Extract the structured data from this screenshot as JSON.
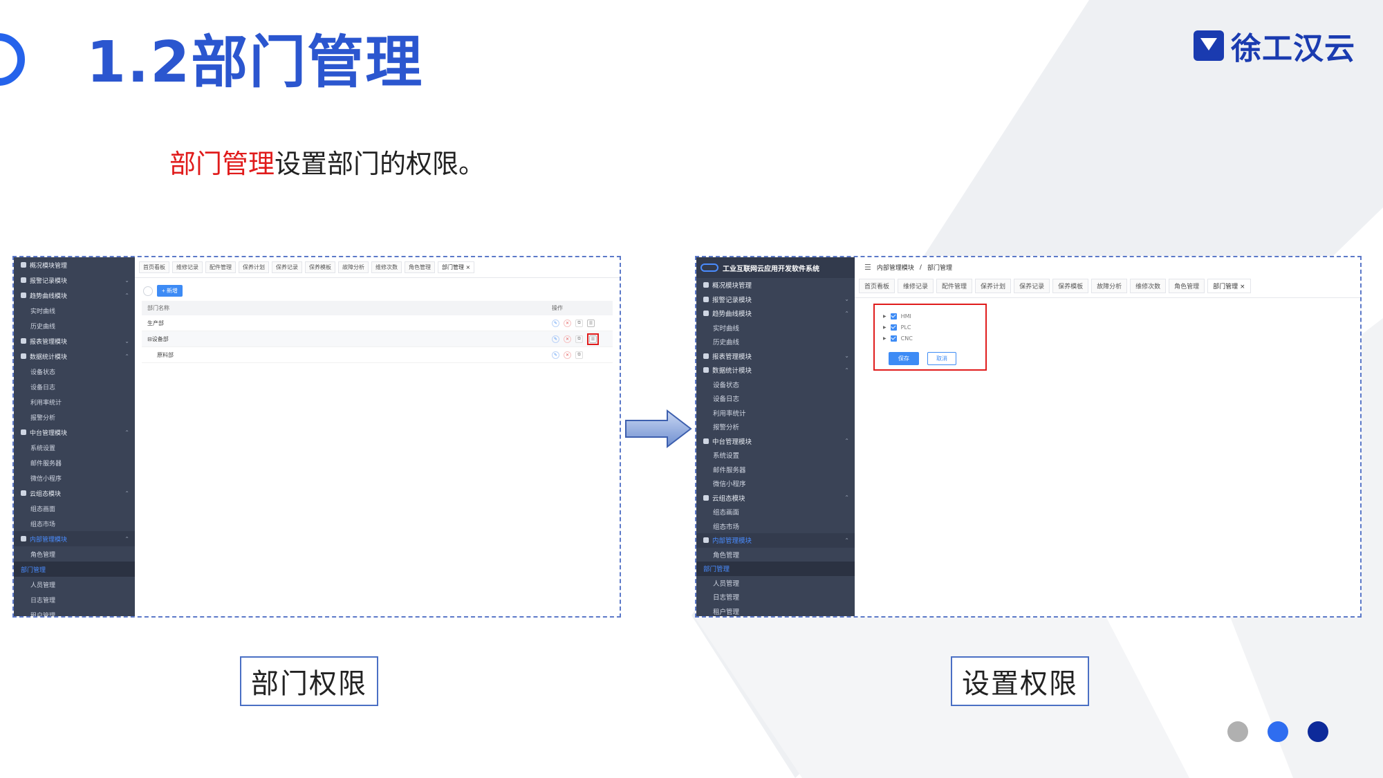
{
  "slide": {
    "title": "1.2部门管理",
    "subtitle_highlight": "部门管理",
    "subtitle_rest": "设置部门的权限。",
    "brand": "徐工汉云",
    "caption_left": "部门权限",
    "caption_right": "设置权限",
    "colors": {
      "title": "#2b56cf",
      "highlight": "#e01b1b",
      "brand": "#1a3bb0"
    },
    "dots": [
      {
        "color": "#b0b0b0"
      },
      {
        "color": "#2f6df0"
      },
      {
        "color": "#0d2a9a"
      }
    ]
  },
  "left_screen": {
    "sidebar": [
      {
        "label": "概况模块管理",
        "type": "parent",
        "icon": "nav-icon"
      },
      {
        "label": "报警记录模块",
        "type": "parent",
        "icon": "nav-icon",
        "chev": "⌄"
      },
      {
        "label": "趋势曲线模块",
        "type": "parent",
        "icon": "nav-icon",
        "chev": "⌃"
      },
      {
        "label": "实时曲线",
        "type": "child"
      },
      {
        "label": "历史曲线",
        "type": "child"
      },
      {
        "label": "报表管理模块",
        "type": "parent",
        "icon": "nav-icon",
        "chev": "⌄"
      },
      {
        "label": "数据统计模块",
        "type": "parent",
        "icon": "nav-icon",
        "chev": "⌃"
      },
      {
        "label": "设备状态",
        "type": "child"
      },
      {
        "label": "设备日志",
        "type": "child"
      },
      {
        "label": "利用率统计",
        "type": "child"
      },
      {
        "label": "报警分析",
        "type": "child"
      },
      {
        "label": "中台管理模块",
        "type": "parent",
        "icon": "nav-icon",
        "chev": "⌃"
      },
      {
        "label": "系统设置",
        "type": "child"
      },
      {
        "label": "邮件服务器",
        "type": "child"
      },
      {
        "label": "微信小程序",
        "type": "child"
      },
      {
        "label": "云组态模块",
        "type": "parent",
        "icon": "nav-icon",
        "chev": "⌃"
      },
      {
        "label": "组态画面",
        "type": "child"
      },
      {
        "label": "组态市场",
        "type": "child"
      },
      {
        "label": "内部管理模块",
        "type": "active-parent",
        "icon": "nav-icon",
        "chev": "⌃"
      },
      {
        "label": "角色管理",
        "type": "child"
      },
      {
        "label": "部门管理",
        "type": "active"
      },
      {
        "label": "人员管理",
        "type": "child"
      },
      {
        "label": "日志管理",
        "type": "child"
      },
      {
        "label": "租户管理",
        "type": "child"
      }
    ],
    "tabs": [
      "首页看板",
      "维修记录",
      "配件管理",
      "保养计划",
      "保养记录",
      "保养模板",
      "故障分析",
      "维修次数",
      "角色管理",
      "部门管理 ×"
    ],
    "add_button": "+ 新增",
    "table_headers": {
      "name": "部门名称",
      "ops": "操作"
    },
    "rows": [
      {
        "name": "生产部",
        "indent": false,
        "highlight": false
      },
      {
        "name": "⊟设备部",
        "indent": false,
        "highlight": true
      },
      {
        "name": "原料部",
        "indent": true,
        "highlight": false
      }
    ],
    "op_glyphs": {
      "edit": "✎",
      "delete": "✕",
      "copy": "⧉",
      "perm": "☰"
    }
  },
  "right_screen": {
    "app_title": "工业互联网云应用开发软件系统",
    "breadcrumb": [
      "内部管理模块",
      "/",
      "部门管理"
    ],
    "breadcrumb_icon": "☰",
    "sidebar": [
      {
        "label": "概况模块管理",
        "type": "parent",
        "icon": "nav-icon"
      },
      {
        "label": "报警记录模块",
        "type": "parent",
        "icon": "nav-icon",
        "chev": "⌄"
      },
      {
        "label": "趋势曲线模块",
        "type": "parent",
        "icon": "nav-icon",
        "chev": "⌃"
      },
      {
        "label": "实时曲线",
        "type": "child"
      },
      {
        "label": "历史曲线",
        "type": "child"
      },
      {
        "label": "报表管理模块",
        "type": "parent",
        "icon": "nav-icon",
        "chev": "⌄"
      },
      {
        "label": "数据统计模块",
        "type": "parent",
        "icon": "nav-icon",
        "chev": "⌃"
      },
      {
        "label": "设备状态",
        "type": "child"
      },
      {
        "label": "设备日志",
        "type": "child"
      },
      {
        "label": "利用率统计",
        "type": "child"
      },
      {
        "label": "报警分析",
        "type": "child"
      },
      {
        "label": "中台管理模块",
        "type": "parent",
        "icon": "nav-icon",
        "chev": "⌃"
      },
      {
        "label": "系统设置",
        "type": "child"
      },
      {
        "label": "邮件服务器",
        "type": "child"
      },
      {
        "label": "微信小程序",
        "type": "child"
      },
      {
        "label": "云组态模块",
        "type": "parent",
        "icon": "nav-icon",
        "chev": "⌃"
      },
      {
        "label": "组态画面",
        "type": "child"
      },
      {
        "label": "组态市场",
        "type": "child"
      },
      {
        "label": "内部管理模块",
        "type": "active-parent",
        "icon": "nav-icon",
        "chev": "⌃"
      },
      {
        "label": "角色管理",
        "type": "child"
      },
      {
        "label": "部门管理",
        "type": "active"
      },
      {
        "label": "人员管理",
        "type": "child"
      },
      {
        "label": "日志管理",
        "type": "child"
      },
      {
        "label": "租户管理",
        "type": "child"
      }
    ],
    "tabs": [
      "首页看板",
      "维修记录",
      "配件管理",
      "保养计划",
      "保养记录",
      "保养模板",
      "故障分析",
      "维修次数",
      "角色管理",
      "部门管理 ×"
    ],
    "tree": [
      {
        "label": "HMI",
        "checked": true
      },
      {
        "label": "PLC",
        "checked": true
      },
      {
        "label": "CNC",
        "checked": true
      }
    ],
    "save_label": "保存",
    "cancel_label": "取消"
  }
}
